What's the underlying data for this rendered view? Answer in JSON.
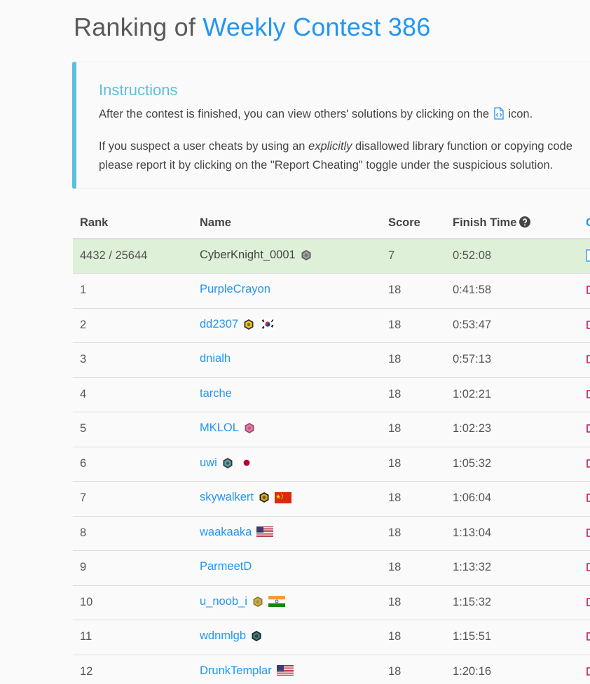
{
  "header": {
    "title_prefix": "Ranking of ",
    "contest_name": "Weekly Contest 386"
  },
  "instructions": {
    "title": "Instructions",
    "p1_before": "After the contest is finished, you can view others' solutions by clicking on the",
    "p1_after": "icon.",
    "p2_before": "If you suspect a user cheats by using an ",
    "p2_em": "explicitly",
    "p2_after": " disallowed library function or copying code",
    "p2_line2": "please report it by clicking on the \"Report Cheating\" toggle under the suspicious solution."
  },
  "table": {
    "columns": {
      "rank": "Rank",
      "name": "Name",
      "score": "Score",
      "finish_time": "Finish Time",
      "extra": "C"
    },
    "current_user": {
      "rank": "4432 / 25644",
      "name": "CyberKnight_0001",
      "score": "7",
      "time": "0:52:08",
      "badge": "gray"
    },
    "rows": [
      {
        "rank": "1",
        "name": "PurpleCrayon",
        "score": "18",
        "time": "0:41:58",
        "badge": "",
        "flag": ""
      },
      {
        "rank": "2",
        "name": "dd2307",
        "score": "18",
        "time": "0:53:47",
        "badge": "gold",
        "flag": "kr"
      },
      {
        "rank": "3",
        "name": "dnialh",
        "score": "18",
        "time": "0:57:13",
        "badge": "",
        "flag": ""
      },
      {
        "rank": "4",
        "name": "tarche",
        "score": "18",
        "time": "1:02:21",
        "badge": "",
        "flag": ""
      },
      {
        "rank": "5",
        "name": "MKLOL",
        "score": "18",
        "time": "1:02:23",
        "badge": "pink",
        "flag": ""
      },
      {
        "rank": "6",
        "name": "uwi",
        "score": "18",
        "time": "1:05:32",
        "badge": "teal",
        "flag": "jp"
      },
      {
        "rank": "7",
        "name": "skywalkert",
        "score": "18",
        "time": "1:06:04",
        "badge": "darkgold",
        "flag": "cn"
      },
      {
        "rank": "8",
        "name": "waakaaka",
        "score": "18",
        "time": "1:13:04",
        "badge": "",
        "flag": "us"
      },
      {
        "rank": "9",
        "name": "ParmeetD",
        "score": "18",
        "time": "1:13:32",
        "badge": "",
        "flag": ""
      },
      {
        "rank": "10",
        "name": "u_noob_i",
        "score": "18",
        "time": "1:15:32",
        "badge": "olive",
        "flag": "in"
      },
      {
        "rank": "11",
        "name": "wdnmlgb",
        "score": "18",
        "time": "1:15:51",
        "badge": "darkteal",
        "flag": ""
      },
      {
        "rank": "12",
        "name": "DrunkTemplar",
        "score": "18",
        "time": "1:20:16",
        "badge": "",
        "flag": "us"
      }
    ]
  },
  "colors": {
    "accent": "#2196f3",
    "info": "#5bc0de",
    "highlight_row": "#dff0d8"
  }
}
